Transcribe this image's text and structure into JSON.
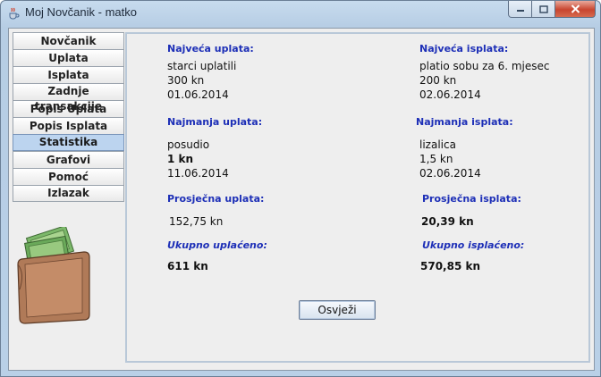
{
  "window": {
    "title": "Moj Novčanik - matko"
  },
  "nav": {
    "items": [
      {
        "label": "Novčanik"
      },
      {
        "label": "Uplata"
      },
      {
        "label": "Isplata"
      },
      {
        "label": "Zadnje transakcije"
      },
      {
        "label": "Popis Uplata"
      },
      {
        "label": "Popis Isplata"
      },
      {
        "label": "Statistika",
        "active": true
      },
      {
        "label": "Grafovi"
      },
      {
        "label": "Pomoć"
      },
      {
        "label": "Izlazak"
      }
    ]
  },
  "stats": {
    "max_income": {
      "heading": "Najveća uplata:",
      "description": "starci uplatili",
      "amount": "300 kn",
      "date": "01.06.2014"
    },
    "max_expense": {
      "heading": "Najveća isplata:",
      "description": "platio sobu za 6. mjesec",
      "amount": "200 kn",
      "date": "02.06.2014"
    },
    "min_income": {
      "heading": "Najmanja uplata:",
      "description": "posudio",
      "amount": "1 kn",
      "date": "11.06.2014"
    },
    "min_expense": {
      "heading": "Najmanja isplata:",
      "description": "lizalica",
      "amount": "1,5 kn",
      "date": "02.06.2014"
    },
    "avg_income": {
      "heading": "Prosječna uplata:",
      "amount": "152,75 kn"
    },
    "avg_expense": {
      "heading": "Prosječna isplata:",
      "amount": "20,39 kn"
    },
    "total_income": {
      "heading": "Ukupno uplaćeno:",
      "amount": "611 kn"
    },
    "total_expense": {
      "heading": "Ukupno isplaćeno:",
      "amount": "570,85 kn"
    }
  },
  "actions": {
    "refresh_label": "Osvježi"
  },
  "colors": {
    "heading": "#1d2fb7",
    "active_nav": "#bcd4ef",
    "close_button": "#c8452f"
  },
  "icons": {
    "app": "java-cup-icon",
    "wallet": "wallet-icon"
  }
}
